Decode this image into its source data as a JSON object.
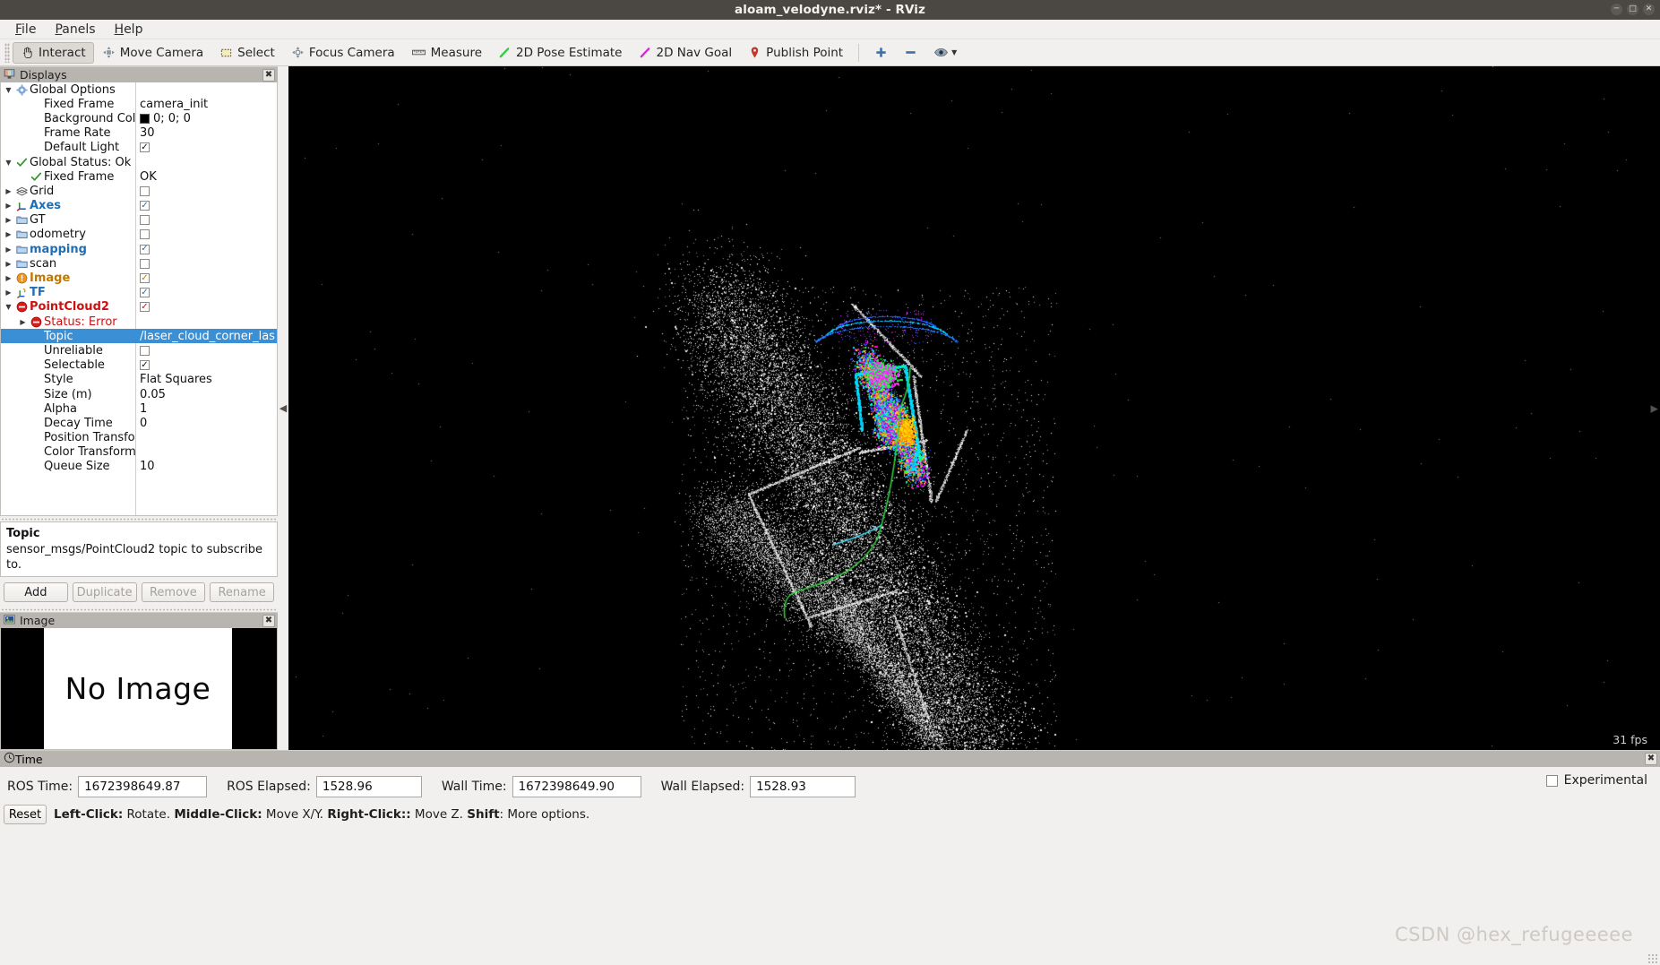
{
  "window": {
    "title": "aloam_velodyne.rviz* - RViz",
    "buttons": [
      "minimize",
      "maximize",
      "close"
    ]
  },
  "menubar": {
    "items": [
      {
        "label": "File",
        "mnemonic": "F"
      },
      {
        "label": "Panels",
        "mnemonic": "P"
      },
      {
        "label": "Help",
        "mnemonic": "H"
      }
    ]
  },
  "toolbar": {
    "tools": [
      {
        "label": "Interact",
        "icon": "hand-icon",
        "active": true
      },
      {
        "label": "Move Camera",
        "icon": "move-camera-icon",
        "active": false
      },
      {
        "label": "Select",
        "icon": "select-rect-icon",
        "active": false
      },
      {
        "label": "Focus Camera",
        "icon": "focus-camera-icon",
        "active": false
      },
      {
        "label": "Measure",
        "icon": "ruler-icon",
        "active": false
      },
      {
        "label": "2D Pose Estimate",
        "icon": "green-arrow-icon",
        "active": false
      },
      {
        "label": "2D Nav Goal",
        "icon": "magenta-arrow-icon",
        "active": false
      },
      {
        "label": "Publish Point",
        "icon": "map-pin-icon",
        "active": false
      }
    ],
    "extra": [
      {
        "icon": "plus-icon",
        "label": "+"
      },
      {
        "icon": "minus-icon",
        "label": "−"
      },
      {
        "icon": "eye-icon",
        "label": "eye"
      }
    ]
  },
  "displays": {
    "title": "Displays",
    "close_label": "✖",
    "rows": [
      {
        "indent": 0,
        "arrow": "down",
        "icon": "gear-icon",
        "label": "Global Options",
        "value": "",
        "style": "plain"
      },
      {
        "indent": 1,
        "arrow": "",
        "icon": "",
        "label": "Fixed Frame",
        "value": "camera_init",
        "style": "plain"
      },
      {
        "indent": 1,
        "arrow": "",
        "icon": "",
        "label": "Background Color",
        "value": "0; 0; 0",
        "value_type": "color",
        "color": "#000000",
        "style": "plain"
      },
      {
        "indent": 1,
        "arrow": "",
        "icon": "",
        "label": "Frame Rate",
        "value": "30",
        "style": "plain"
      },
      {
        "indent": 1,
        "arrow": "",
        "icon": "",
        "label": "Default Light",
        "value": "",
        "value_type": "checkbox",
        "checked": true,
        "check_color": "#111111",
        "style": "plain"
      },
      {
        "indent": 0,
        "arrow": "down",
        "icon": "check-icon",
        "label": "Global Status: Ok",
        "value": "",
        "style": "plain"
      },
      {
        "indent": 1,
        "arrow": "",
        "icon": "check-icon",
        "label": "Fixed Frame",
        "value": "OK",
        "style": "plain"
      },
      {
        "indent": 0,
        "arrow": "right",
        "icon": "grid-icon",
        "label": "Grid",
        "value": "",
        "value_type": "checkbox",
        "checked": false,
        "style": "plain"
      },
      {
        "indent": 0,
        "arrow": "right",
        "icon": "axes-icon",
        "label": "Axes",
        "value": "",
        "value_type": "checkbox",
        "checked": true,
        "check_color": "#1f6fb5",
        "style": "blue"
      },
      {
        "indent": 0,
        "arrow": "right",
        "icon": "folder-icon",
        "label": "GT",
        "value": "",
        "value_type": "checkbox",
        "checked": false,
        "style": "plain"
      },
      {
        "indent": 0,
        "arrow": "right",
        "icon": "folder-icon",
        "label": "odometry",
        "value": "",
        "value_type": "checkbox",
        "checked": false,
        "style": "plain"
      },
      {
        "indent": 0,
        "arrow": "right",
        "icon": "folder-icon",
        "label": "mapping",
        "value": "",
        "value_type": "checkbox",
        "checked": true,
        "check_color": "#1f6fb5",
        "style": "blue"
      },
      {
        "indent": 0,
        "arrow": "right",
        "icon": "folder-icon",
        "label": "scan",
        "value": "",
        "value_type": "checkbox",
        "checked": false,
        "style": "plain"
      },
      {
        "indent": 0,
        "arrow": "right",
        "icon": "warning-icon",
        "label": "Image",
        "value": "",
        "value_type": "checkbox",
        "checked": true,
        "check_color": "#c07800",
        "style": "orange"
      },
      {
        "indent": 0,
        "arrow": "right",
        "icon": "tf-icon",
        "label": "TF",
        "value": "",
        "value_type": "checkbox",
        "checked": true,
        "check_color": "#1f6fb5",
        "style": "blue"
      },
      {
        "indent": 0,
        "arrow": "down",
        "icon": "error-icon",
        "label": "PointCloud2",
        "value": "",
        "value_type": "checkbox",
        "checked": true,
        "check_color": "#cc1111",
        "style": "red"
      },
      {
        "indent": 1,
        "arrow": "right",
        "icon": "error-icon",
        "label": "Status: Error",
        "value": "",
        "style": "red-plain"
      },
      {
        "indent": 1,
        "arrow": "",
        "icon": "",
        "label": "Topic",
        "value": "/laser_cloud_corner_last",
        "style": "selected"
      },
      {
        "indent": 1,
        "arrow": "",
        "icon": "",
        "label": "Unreliable",
        "value": "",
        "value_type": "checkbox",
        "checked": false,
        "style": "plain"
      },
      {
        "indent": 1,
        "arrow": "",
        "icon": "",
        "label": "Selectable",
        "value": "",
        "value_type": "checkbox",
        "checked": true,
        "check_color": "#111111",
        "style": "plain"
      },
      {
        "indent": 1,
        "arrow": "",
        "icon": "",
        "label": "Style",
        "value": "Flat Squares",
        "style": "plain"
      },
      {
        "indent": 1,
        "arrow": "",
        "icon": "",
        "label": "Size (m)",
        "value": "0.05",
        "style": "plain"
      },
      {
        "indent": 1,
        "arrow": "",
        "icon": "",
        "label": "Alpha",
        "value": "1",
        "style": "plain"
      },
      {
        "indent": 1,
        "arrow": "",
        "icon": "",
        "label": "Decay Time",
        "value": "0",
        "style": "plain"
      },
      {
        "indent": 1,
        "arrow": "",
        "icon": "",
        "label": "Position Transfor…",
        "value": "",
        "style": "plain"
      },
      {
        "indent": 1,
        "arrow": "",
        "icon": "",
        "label": "Color Transformer",
        "value": "",
        "style": "plain"
      },
      {
        "indent": 1,
        "arrow": "",
        "icon": "",
        "label": "Queue Size",
        "value": "10",
        "style": "plain"
      }
    ],
    "description": {
      "title": "Topic",
      "text": "sensor_msgs/PointCloud2 topic to subscribe to."
    },
    "buttons": [
      {
        "label": "Add",
        "enabled": true
      },
      {
        "label": "Duplicate",
        "enabled": false
      },
      {
        "label": "Remove",
        "enabled": false
      },
      {
        "label": "Rename",
        "enabled": false
      }
    ]
  },
  "image_panel": {
    "title": "Image",
    "close_label": "✖",
    "message": "No Image"
  },
  "viewport": {
    "fps": "31 fps",
    "background_color": "#000000"
  },
  "time_panel": {
    "title": "Time",
    "close_label": "✖",
    "fields": [
      {
        "label": "ROS Time:",
        "value": "1672398649.87",
        "width": "wide"
      },
      {
        "label": "ROS Elapsed:",
        "value": "1528.96",
        "width": "narrow"
      },
      {
        "label": "Wall Time:",
        "value": "1672398649.90",
        "width": "wide"
      },
      {
        "label": "Wall Elapsed:",
        "value": "1528.93",
        "width": "narrow"
      }
    ],
    "experimental": {
      "label": "Experimental",
      "checked": false
    },
    "reset_label": "Reset",
    "hint": [
      {
        "text": "Left-Click:",
        "bold": true
      },
      {
        "text": " Rotate. ",
        "bold": false
      },
      {
        "text": "Middle-Click:",
        "bold": true
      },
      {
        "text": " Move X/Y. ",
        "bold": false
      },
      {
        "text": "Right-Click::",
        "bold": true
      },
      {
        "text": " Move Z. ",
        "bold": false
      },
      {
        "text": "Shift",
        "bold": true
      },
      {
        "text": ": More options.",
        "bold": false
      }
    ]
  },
  "watermark": {
    "text": "CSDN @hex_refugeeeee"
  }
}
